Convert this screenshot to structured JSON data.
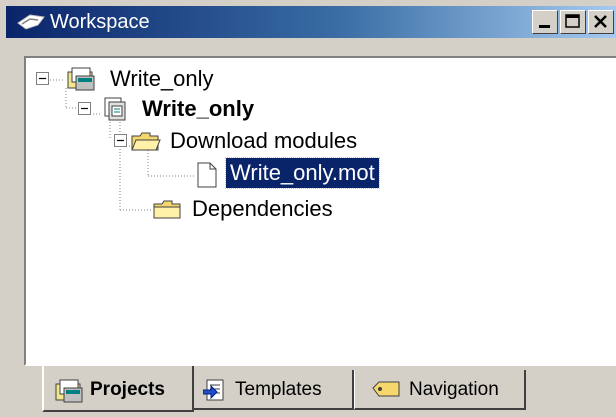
{
  "window": {
    "title": "Workspace",
    "icon": "workspace-icon",
    "buttons": [
      "minimize",
      "maximize",
      "close"
    ]
  },
  "tree": [
    {
      "label": "Write_only",
      "icon": "workspace-folder-icon",
      "expanded": true,
      "bold": false
    },
    {
      "label": "Write_only",
      "icon": "project-icon",
      "expanded": true,
      "bold": true
    },
    {
      "label": "Download modules",
      "icon": "folder-open-icon",
      "expanded": true,
      "bold": false
    },
    {
      "label": "Write_only.mot",
      "icon": "document-icon",
      "selected": true,
      "bold": false
    },
    {
      "label": "Dependencies",
      "icon": "folder-icon",
      "bold": false
    }
  ],
  "tabs": [
    {
      "label": "Projects",
      "icon": "projects-icon",
      "active": true
    },
    {
      "label": "Templates",
      "icon": "templates-icon",
      "active": false
    },
    {
      "label": "Navigation",
      "icon": "navigation-icon",
      "active": false
    }
  ],
  "colors": {
    "titlebar_start": "#0a246a",
    "titlebar_end": "#a6caf0",
    "selection": "#0a246a",
    "face": "#d4d0c8"
  }
}
